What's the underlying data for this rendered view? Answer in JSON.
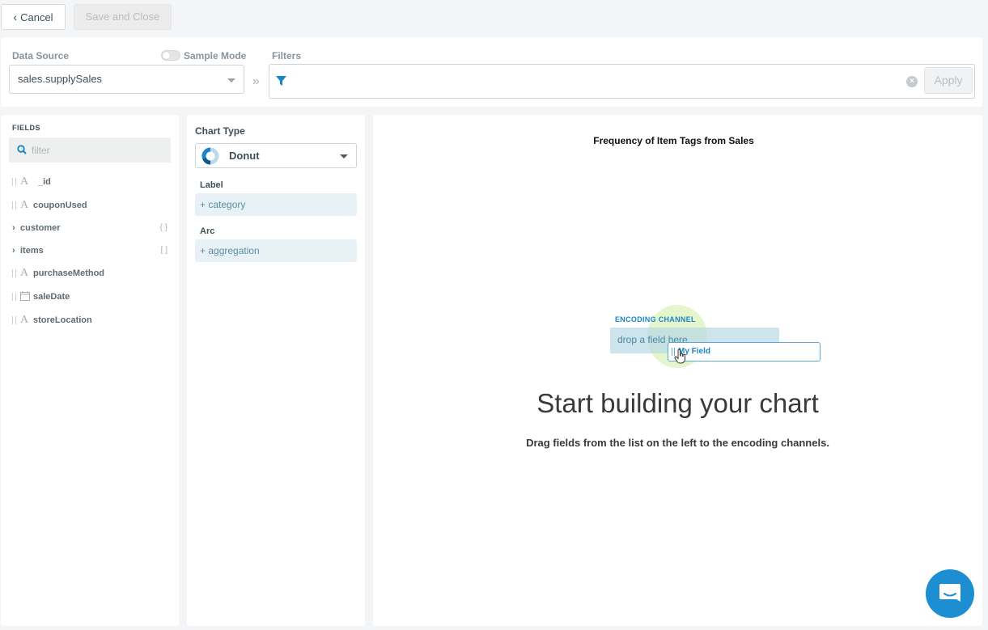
{
  "toolbar": {
    "cancel_label": "Cancel",
    "save_label": "Save and Close"
  },
  "data_source": {
    "label": "Data Source",
    "value": "sales.supplySales",
    "sample_mode_label": "Sample Mode",
    "sample_mode_on": false
  },
  "filters": {
    "label": "Filters",
    "apply_label": "Apply"
  },
  "fields": {
    "title": "FIELDS",
    "filter_placeholder": "filter",
    "items": [
      {
        "name": "_id",
        "type": "string"
      },
      {
        "name": "couponUsed",
        "type": "string"
      },
      {
        "name": "customer",
        "type": "object",
        "badge": "{ }"
      },
      {
        "name": "items",
        "type": "array",
        "badge": "[ ]"
      },
      {
        "name": "purchaseMethod",
        "type": "string"
      },
      {
        "name": "saleDate",
        "type": "date"
      },
      {
        "name": "storeLocation",
        "type": "string"
      }
    ]
  },
  "chart_type": {
    "title": "Chart Type",
    "selected": "Donut",
    "encodings": [
      {
        "label": "Label",
        "drop": "+ category"
      },
      {
        "label": "Arc",
        "drop": "+ aggregation"
      }
    ]
  },
  "canvas": {
    "chart_title": "Frequency of Item Tags from Sales",
    "illustration": {
      "channel_label": "ENCODING CHANNEL",
      "drop_text": "drop a field here",
      "field_text": "My Field"
    },
    "heading": "Start building your chart",
    "subheading": "Drag fields from the list on the left to the encoding channels."
  },
  "colors": {
    "accent": "#1b83c8",
    "chat": "#1d8ed1"
  }
}
